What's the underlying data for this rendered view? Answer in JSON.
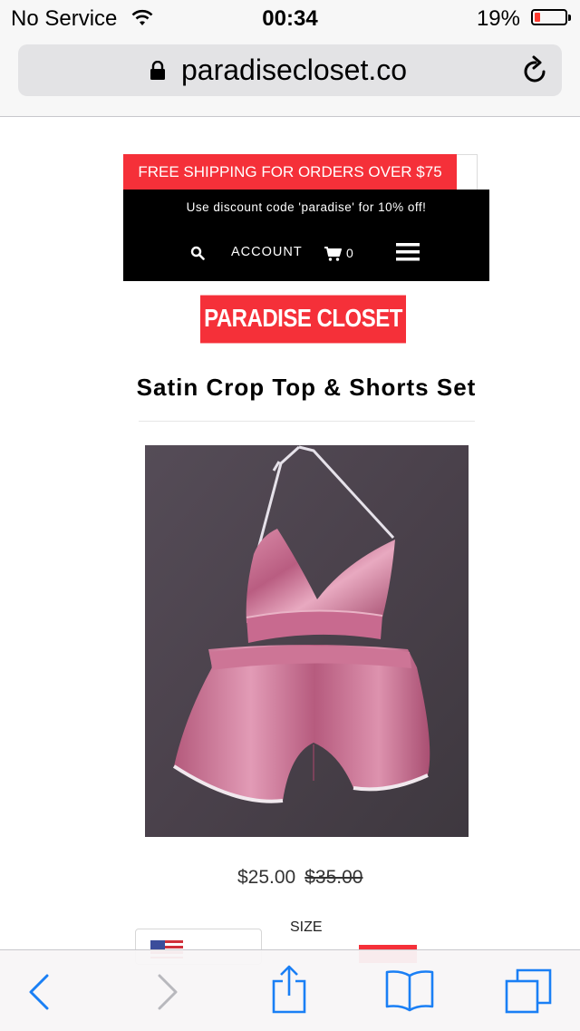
{
  "status_bar": {
    "carrier": "No Service",
    "time": "00:34",
    "battery_percent": "19%",
    "battery_level": 0.19,
    "wifi_icon": "wifi-icon",
    "battery_color": "#ff3b30"
  },
  "address_bar": {
    "url": "paradisecloset.co",
    "lock_icon": "lock-icon",
    "reload_icon": "reload-icon"
  },
  "site": {
    "promo_banner": "FREE SHIPPING FOR ORDERS OVER $75",
    "discount_notice": "Use discount code 'paradise' for 10% off!",
    "nav": {
      "search_icon": "search-icon",
      "account_label": "ACCOUNT",
      "cart_icon": "cart-icon",
      "cart_count": "0",
      "menu_icon": "hamburger-menu-icon"
    },
    "logo_text": "PARADISE CLOSET CO.",
    "brand_color": "#f53039"
  },
  "product": {
    "title": "Satin Crop Top & Shorts Set",
    "image_alt": "pink satin halter crop top and shorts",
    "price": "$25.00",
    "compare_at_price": "$35.00",
    "size_label": "SIZE",
    "currency_flag_icon": "us-flag-icon"
  },
  "toolbar": {
    "back_icon": "back-chevron-icon",
    "forward_icon": "forward-chevron-icon",
    "share_icon": "share-icon",
    "bookmarks_icon": "bookmarks-icon",
    "tabs_icon": "tabs-icon",
    "accent_color": "#1a7ff5"
  }
}
